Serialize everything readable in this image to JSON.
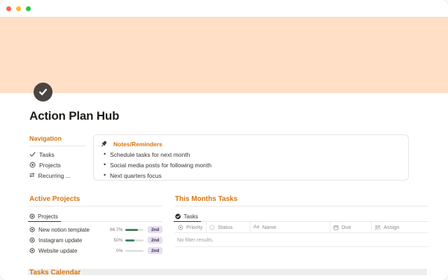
{
  "window": {
    "controls": [
      "close",
      "minimize",
      "zoom"
    ]
  },
  "page": {
    "icon": "check-circle-icon",
    "title": "Action Plan Hub"
  },
  "navigation": {
    "title": "Navigation",
    "items": [
      {
        "icon": "checkmark-icon",
        "label": "Tasks"
      },
      {
        "icon": "target-icon",
        "label": "Projects"
      },
      {
        "icon": "recurring-icon",
        "label": "Recurring ..."
      }
    ]
  },
  "callout": {
    "icon": "pin-icon",
    "title": "Notes/Reminders",
    "bullets": [
      "Schedule tasks for next month",
      "Social media posts for following month",
      "Next quarters focus"
    ]
  },
  "active_projects": {
    "title": "Active Projects",
    "tab": "Projects",
    "rows": [
      {
        "icon": "target-icon",
        "name": "New notion template",
        "percent": "66.7%",
        "progress": 66.7,
        "badge": "2nd"
      },
      {
        "icon": "target-icon",
        "name": "Instagram update",
        "percent": "50%",
        "progress": 50,
        "badge": "2nd"
      },
      {
        "icon": "target-icon",
        "name": "Website update",
        "percent": "0%",
        "progress": 0,
        "badge": "2nd"
      }
    ]
  },
  "month_tasks": {
    "title": "This Months Tasks",
    "tab": "Tasks",
    "tab_icon": "check-circle-icon",
    "columns": [
      {
        "icon": "priority-icon",
        "label": "Priority"
      },
      {
        "icon": "status-icon",
        "label": "Status"
      },
      {
        "icon": "text-icon",
        "label": "Name"
      },
      {
        "icon": "calendar-icon",
        "label": "Due"
      },
      {
        "icon": "people-icon",
        "label": "Assign"
      }
    ],
    "empty_text": "No filter results."
  },
  "tasks_calendar": {
    "title": "Tasks Calendar"
  },
  "colors": {
    "accent": "#d9730d",
    "cover": "#ffdfc6",
    "page_icon_bg": "#4a4540",
    "progress_fill": "#448361",
    "badge_bg": "#e7deee",
    "traffic_close": "#ff5f57",
    "traffic_minimize": "#febc2e",
    "traffic_zoom": "#28c840"
  }
}
